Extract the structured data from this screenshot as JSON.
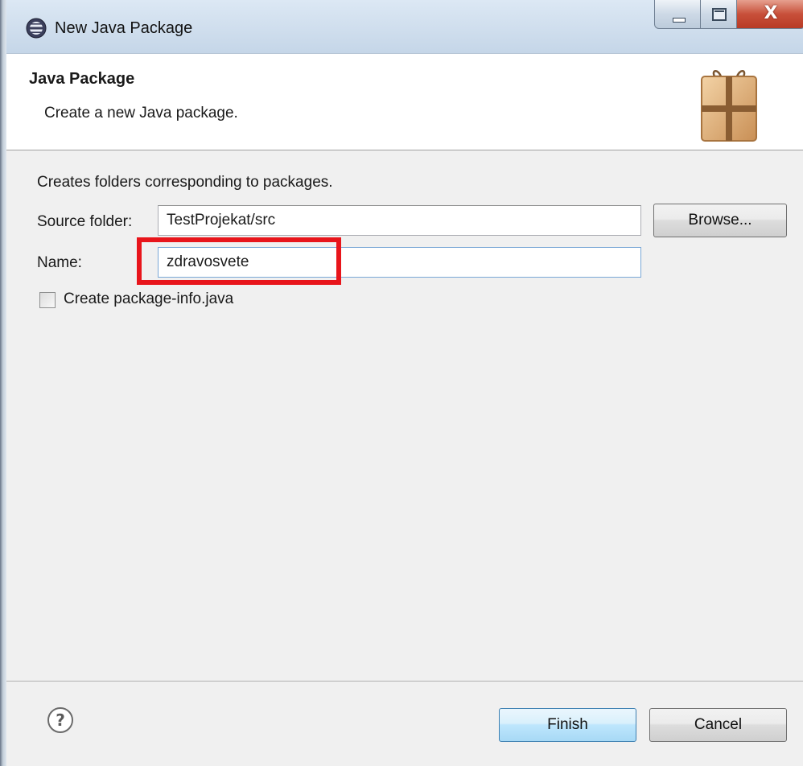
{
  "window": {
    "title": "New Java Package",
    "controls": {
      "minimize": "minimize-icon",
      "maximize": "maximize-icon",
      "close": "X"
    }
  },
  "header": {
    "title": "Java Package",
    "description": "Create a new Java package.",
    "icon": "package-icon"
  },
  "form": {
    "description": "Creates folders corresponding to packages.",
    "source_folder_label": "Source folder:",
    "source_folder_value": "TestProjekat/src",
    "browse_label": "Browse...",
    "name_label": "Name:",
    "name_value": "zdravosvete",
    "create_package_info_label": "Create package-info.java",
    "create_package_info_checked": false
  },
  "footer": {
    "help_icon": "help-icon",
    "finish_label": "Finish",
    "cancel_label": "Cancel"
  },
  "colors": {
    "highlight": "#e8151b",
    "default_button": "#bee6fd",
    "title_bar": "#c5d6e8"
  }
}
